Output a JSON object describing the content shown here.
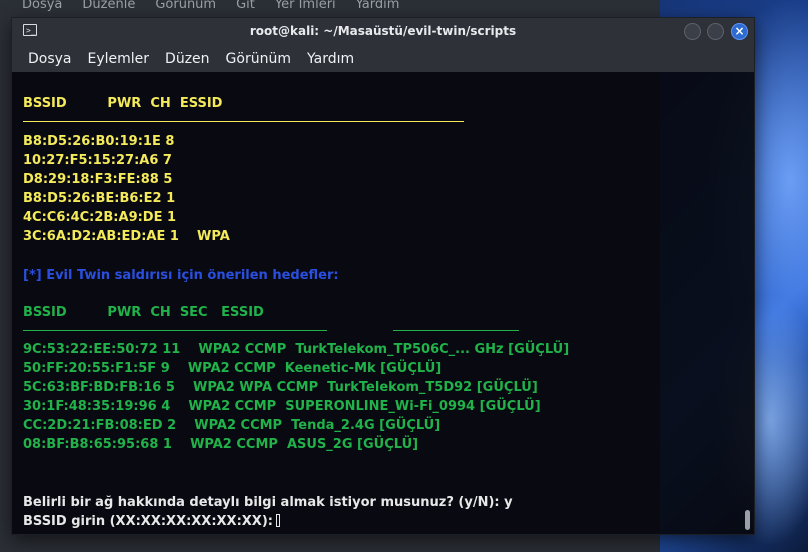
{
  "background_window": {
    "menu": [
      "Dosya",
      "Düzenle",
      "Görünüm",
      "Git",
      "Yer İmleri",
      "Yardım"
    ]
  },
  "terminal": {
    "title": "root@kali: ~/Masaüstü/evil-twin/scripts",
    "menu": [
      "Dosya",
      "Eylemler",
      "Düzen",
      "Görünüm",
      "Yardım"
    ],
    "colors": {
      "yellow": "#f4ea5a",
      "blue": "#2a4fe0",
      "green": "#21b24a",
      "white": "#e8e8e8",
      "close_button": "#2d6bd1"
    },
    "scan_header": "BSSID         PWR  CH  ESSID",
    "scan_rows": [
      "B8:D5:26:B0:19:1E 8",
      "10:27:F5:15:27:A6 7",
      "D8:29:18:F3:FE:88 5",
      "B8:D5:26:BE:B6:E2 1",
      "4C:C6:4C:2B:A9:DE 1",
      "3C:6A:D2:AB:ED:AE 1    WPA"
    ],
    "recommend_title": "[*] Evil Twin saldırısı için önerilen hedefler:",
    "target_header": "BSSID         PWR  CH  SEC   ESSID",
    "target_rows": [
      "9C:53:22:EE:50:72 11    WPA2 CCMP  TurkTelekom_TP506C_... GHz [GÜÇLÜ]",
      "50:FF:20:55:F1:5F 9    WPA2 CCMP  Keenetic-Mk [GÜÇLÜ]",
      "5C:63:BF:BD:FB:16 5    WPA2 WPA CCMP  TurkTelekom_T5D92 [GÜÇLÜ]",
      "30:1F:48:35:19:96 4    WPA2 CCMP  SUPERONLINE_Wi-Fi_0994 [GÜÇLÜ]",
      "CC:2D:21:FB:08:ED 2    WPA2 CCMP  Tenda_2.4G [GÜÇLÜ]",
      "08:BF:B8:65:95:68 1    WPA2 CCMP  ASUS_2G [GÜÇLÜ]"
    ],
    "prompt_question": "Belirli bir ağ hakkında detaylı bilgi almak istiyor musunuz? (y/N): y",
    "prompt_bssid": "BSSID girin (XX:XX:XX:XX:XX:XX):"
  }
}
